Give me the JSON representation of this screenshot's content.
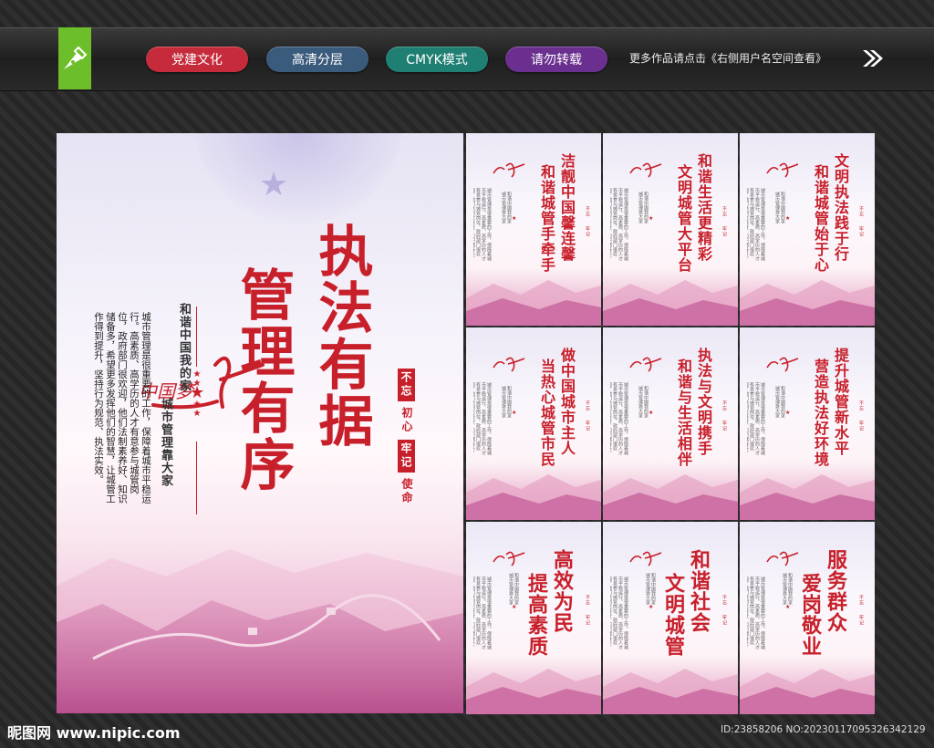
{
  "toolbar": {
    "tags": [
      {
        "label": "党建文化",
        "color": "#c62b3b"
      },
      {
        "label": "高清分层",
        "color": "#3b5b7c"
      },
      {
        "label": "CMYK模式",
        "color": "#1f7f72"
      },
      {
        "label": "请勿转载",
        "color": "#6b2f8f"
      }
    ],
    "promo_text": "更多作品请点击《右侧用户名空间查看》"
  },
  "main_poster": {
    "title_line1": "执法有据",
    "title_line2": "管理有序",
    "slogan_a": "不忘",
    "slogan_a2": "初心",
    "slogan_b": "牢记",
    "slogan_b2": "使命",
    "dream_logo": "中国梦",
    "subtitle_1": "和谐中国我的家",
    "subtitle_2": "城市管理靠大家",
    "body_text": "城市管理是很重要的工作，保障着城市平稳运行。高素质、高学历的人才有意参与城管岗位，政府部门很欢迎，他们法制素养好、知识储备多，希望更多发挥他们的智慧，让城管工作得到提升，坚持行为规范、执法实效。"
  },
  "panels": [
    {
      "line1": "洁靓中国馨连馨",
      "line2": "和谐城管手牵手"
    },
    {
      "line1": "和谐生活更精彩",
      "line2": "文明城管大平台"
    },
    {
      "line1": "文明执法践于行",
      "line2": "和谐城管始于心"
    },
    {
      "line1": "做中国城市主人",
      "line2": "当热心城管市民"
    },
    {
      "line1": "执法与文明携手",
      "line2": "和谐与生活相伴"
    },
    {
      "line1": "提升城管新水平",
      "line2": "营造执法好环境"
    },
    {
      "line1": "高效为民",
      "line2": "提高素质"
    },
    {
      "line1": "和谐社会",
      "line2": "文明城管"
    },
    {
      "line1": "服务群众",
      "line2": "爱岗敬业"
    }
  ],
  "footer": {
    "site": "昵图网 www.nipic.com",
    "id_text": "ID:23858206 NO:20230117095326342129"
  },
  "colors": {
    "accent_red": "#c8202b",
    "logo_green": "#6cbf2a"
  }
}
